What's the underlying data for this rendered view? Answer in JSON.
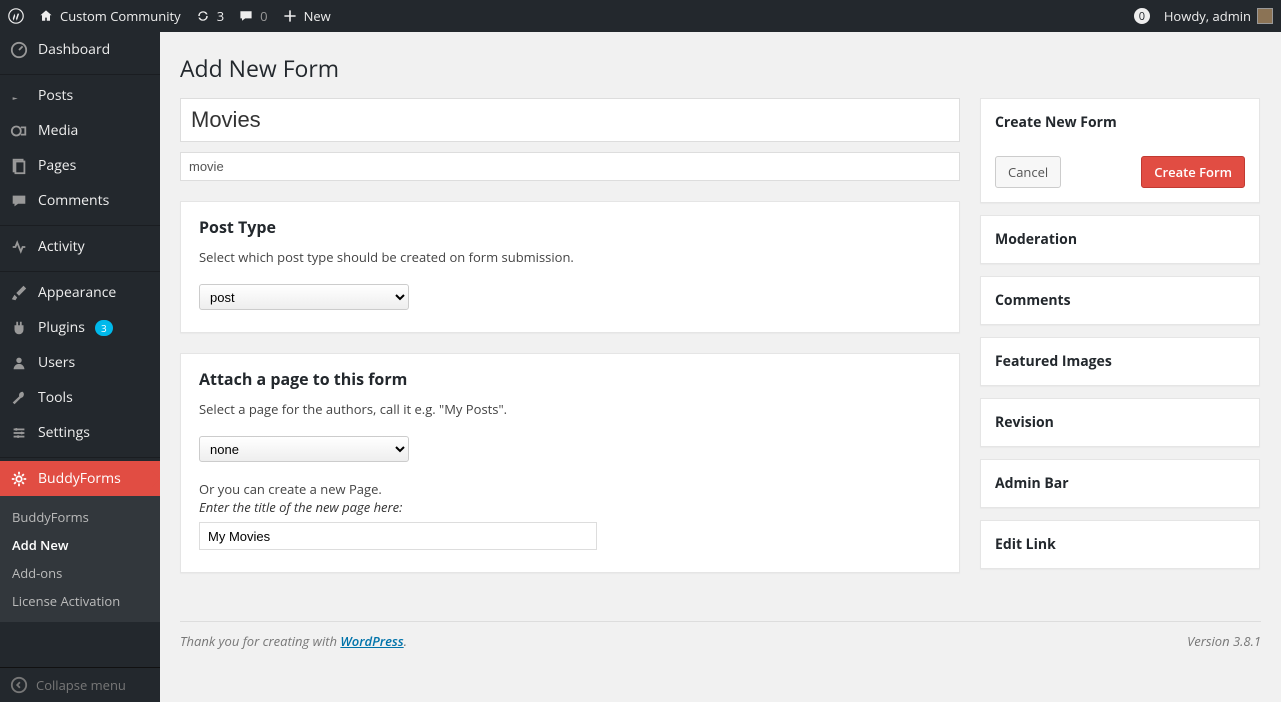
{
  "adminbar": {
    "site_name": "Custom Community",
    "updates": "3",
    "comments": "0",
    "new_label": "New",
    "badge_right": "0",
    "howdy": "Howdy, admin"
  },
  "sidebar": {
    "items": [
      {
        "label": "Dashboard",
        "icon": "dashboard"
      },
      {
        "label": "Posts",
        "icon": "pin"
      },
      {
        "label": "Media",
        "icon": "media"
      },
      {
        "label": "Pages",
        "icon": "pages"
      },
      {
        "label": "Comments",
        "icon": "comment"
      },
      {
        "label": "Activity",
        "icon": "activity"
      },
      {
        "label": "Appearance",
        "icon": "brush"
      },
      {
        "label": "Plugins",
        "icon": "plug",
        "badge": "3"
      },
      {
        "label": "Users",
        "icon": "user"
      },
      {
        "label": "Tools",
        "icon": "wrench"
      },
      {
        "label": "Settings",
        "icon": "settings"
      },
      {
        "label": "BuddyForms",
        "icon": "gear"
      }
    ],
    "submenu": [
      {
        "label": "BuddyForms"
      },
      {
        "label": "Add New",
        "current": true
      },
      {
        "label": "Add-ons"
      },
      {
        "label": "License Activation"
      }
    ],
    "collapse": "Collapse menu"
  },
  "page": {
    "heading": "Add New Form",
    "form_title": "Movies",
    "form_slug": "movie"
  },
  "postbox_posttype": {
    "title": "Post Type",
    "desc": "Select which post type should be created on form submission.",
    "selected": "post"
  },
  "postbox_attach": {
    "title": "Attach a page to this form",
    "desc": "Select a page for the authors, call it e.g. \"My Posts\".",
    "selected": "none",
    "or_text": "Or you can create a new Page.",
    "hint": "Enter the title of the new page here:",
    "new_page": "My Movies"
  },
  "publishbox": {
    "title": "Create New Form",
    "cancel": "Cancel",
    "submit": "Create Form"
  },
  "side_panels": [
    "Moderation",
    "Comments",
    "Featured Images",
    "Revision",
    "Admin Bar",
    "Edit Link"
  ],
  "footer": {
    "thanks_prefix": "Thank you for creating with ",
    "wp": "WordPress",
    "version": "Version 3.8.1"
  }
}
